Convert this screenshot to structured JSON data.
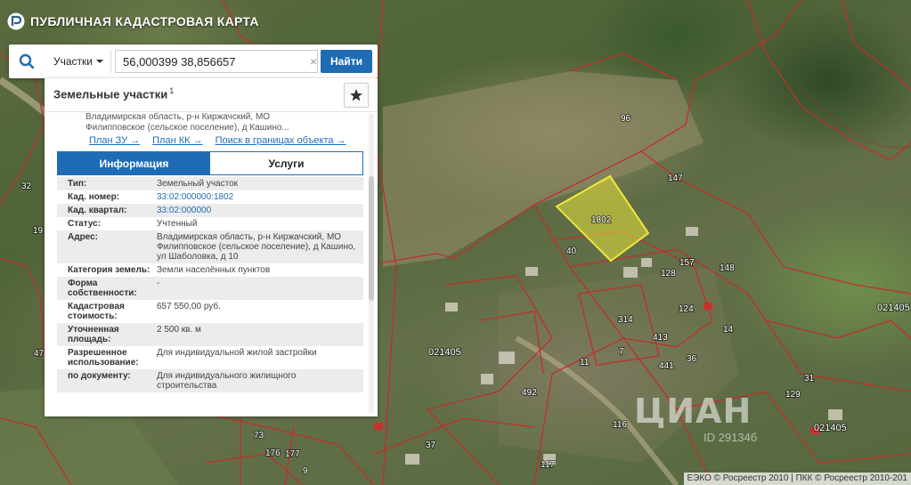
{
  "app": {
    "title": "ПУБЛИЧНАЯ КАДАСТРОВАЯ КАРТА",
    "logo_icon": "rosreestr-logo-icon"
  },
  "search": {
    "type_label": "Участки",
    "query": "56,000399 38,856657",
    "clear_symbol": "×",
    "button_label": "Найти",
    "icon": "search-icon"
  },
  "panel": {
    "title": "Земельные участки",
    "count": "1",
    "favorite_icon": "star-icon",
    "address_line1": "Владимирская область, р-н Киржачский, МО",
    "address_line2": "Филипповское (сельское поселение), д Кашино...",
    "links": [
      "План ЗУ →",
      "План КК →",
      "Поиск в границах объекта →"
    ],
    "tabs": [
      "Информация",
      "Услуги"
    ],
    "active_tab": "Информация",
    "attributes": [
      {
        "key": "Тип:",
        "value": "Земельный участок"
      },
      {
        "key": "Кад. номер:",
        "value": "33:02:000000:1802"
      },
      {
        "key": "Кад. квартал:",
        "value": "33:02:000000"
      },
      {
        "key": "Статус:",
        "value": "Учтенный"
      },
      {
        "key": "Адрес:",
        "value": "Владимирская область, р-н Киржачский, МО Филипповское (сельское поселение), д Кашино, ул Шаболовка, д 10"
      },
      {
        "key": "Категория земель:",
        "value": "Земли населённых пунктов"
      },
      {
        "key": "Форма собственности:",
        "value": "-"
      },
      {
        "key": "Кадастровая стоимость:",
        "value": "657 550,00 руб."
      },
      {
        "key": "Уточненная площадь:",
        "value": "2 500 кв. м"
      },
      {
        "key": "Разрешенное использование:",
        "value": "Для индивидуальной жилой застройки"
      },
      {
        "key": "по документу:",
        "value": "Для индивидуального жилищного строительства"
      }
    ]
  },
  "map": {
    "highlight_color": "#e8e23a",
    "boundary_color": "#c0302c",
    "selected_parcel_label": "1802",
    "plot_labels": [
      "96",
      "147",
      "40",
      "157",
      "148",
      "128",
      "124",
      "14",
      "36",
      "314",
      "413",
      "441",
      "7",
      "11",
      "492",
      "116",
      "117",
      "37",
      "73",
      "176",
      "177",
      "9",
      "31",
      "129",
      "32",
      "19",
      "47"
    ],
    "quarter_labels": [
      "021405",
      "021405",
      "021405"
    ]
  },
  "watermark": {
    "text": "ЦИАН",
    "id_text": "ID 29134б"
  },
  "attribution": "ЕЭКО © Росреестр 2010 | ПКК © Росреестр 2010-201"
}
